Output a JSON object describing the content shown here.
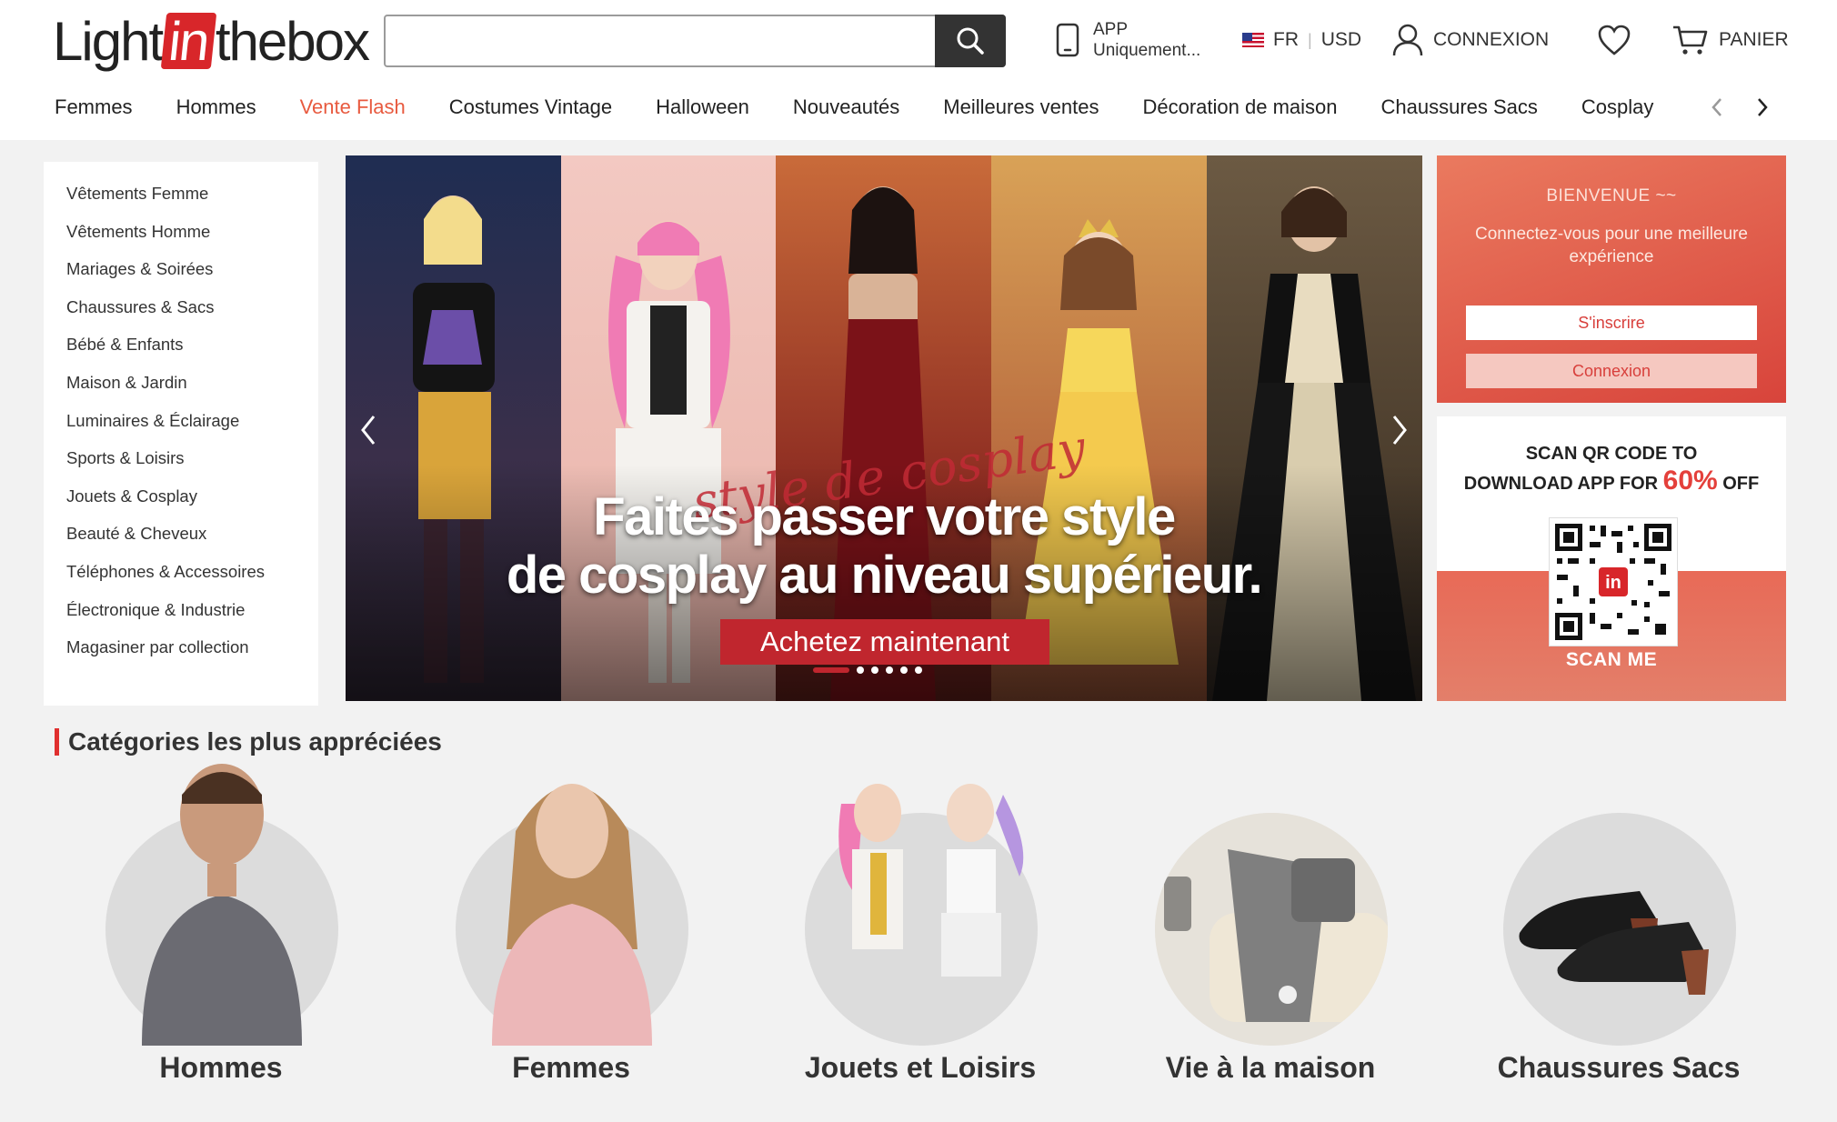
{
  "header": {
    "logo_prefix": "Light",
    "logo_box": "in",
    "logo_suffix": "thebox",
    "search_placeholder": "",
    "app_line1": "APP",
    "app_line2": "Uniquement...",
    "lang": "FR",
    "currency": "USD",
    "login": "CONNEXION",
    "cart": "PANIER"
  },
  "nav": {
    "items": [
      "Femmes",
      "Hommes",
      "Vente Flash",
      "Costumes Vintage",
      "Halloween",
      "Nouveautés",
      "Meilleures ventes",
      "Décoration de maison",
      "Chaussures Sacs",
      "Cosplay"
    ],
    "active_index": 2
  },
  "sidebar": {
    "items": [
      "Vêtements Femme",
      "Vêtements Homme",
      "Mariages & Soirées",
      "Chaussures & Sacs",
      "Bébé & Enfants",
      "Maison & Jardin",
      "Luminaires & Éclairage",
      "Sports & Loisirs",
      "Jouets & Cosplay",
      "Beauté & Cheveux",
      "Téléphones & Accessoires",
      "Électronique & Industrie",
      "Magasiner par collection"
    ]
  },
  "banner": {
    "script_text": "style de cosplay",
    "headline_line1": "Faites passer votre style",
    "headline_line2": "de cosplay au niveau supérieur.",
    "cta": "Achetez maintenant",
    "slide_count": 6,
    "active_slide": 0
  },
  "welcome": {
    "title": "BIENVENUE ~~",
    "subtitle": "Connectez-vous pour une meilleure expérience",
    "signup": "S'inscrire",
    "login": "Connexion"
  },
  "qr": {
    "line1": "SCAN QR CODE TO",
    "line2_prefix": "DOWNLOAD APP FOR ",
    "line2_pct": "60%",
    "line2_suffix": " OFF",
    "center_badge": "in",
    "scan_label": "SCAN ME"
  },
  "categories": {
    "heading": "Catégories les plus appréciées",
    "items": [
      "Hommes",
      "Femmes",
      "Jouets et Loisirs",
      "Vie à la maison",
      "Chaussures Sacs"
    ]
  },
  "colors": {
    "brand_red": "#d8262a",
    "active_nav": "#e85a3f",
    "cta_red": "#c0262e",
    "welcome_gradient_start": "#ea7a5f",
    "welcome_gradient_end": "#d8443b"
  },
  "icons": [
    "search-icon",
    "phone-icon",
    "us-flag-icon",
    "user-icon",
    "heart-icon",
    "cart-icon",
    "chevron-left-icon",
    "chevron-right-icon"
  ]
}
